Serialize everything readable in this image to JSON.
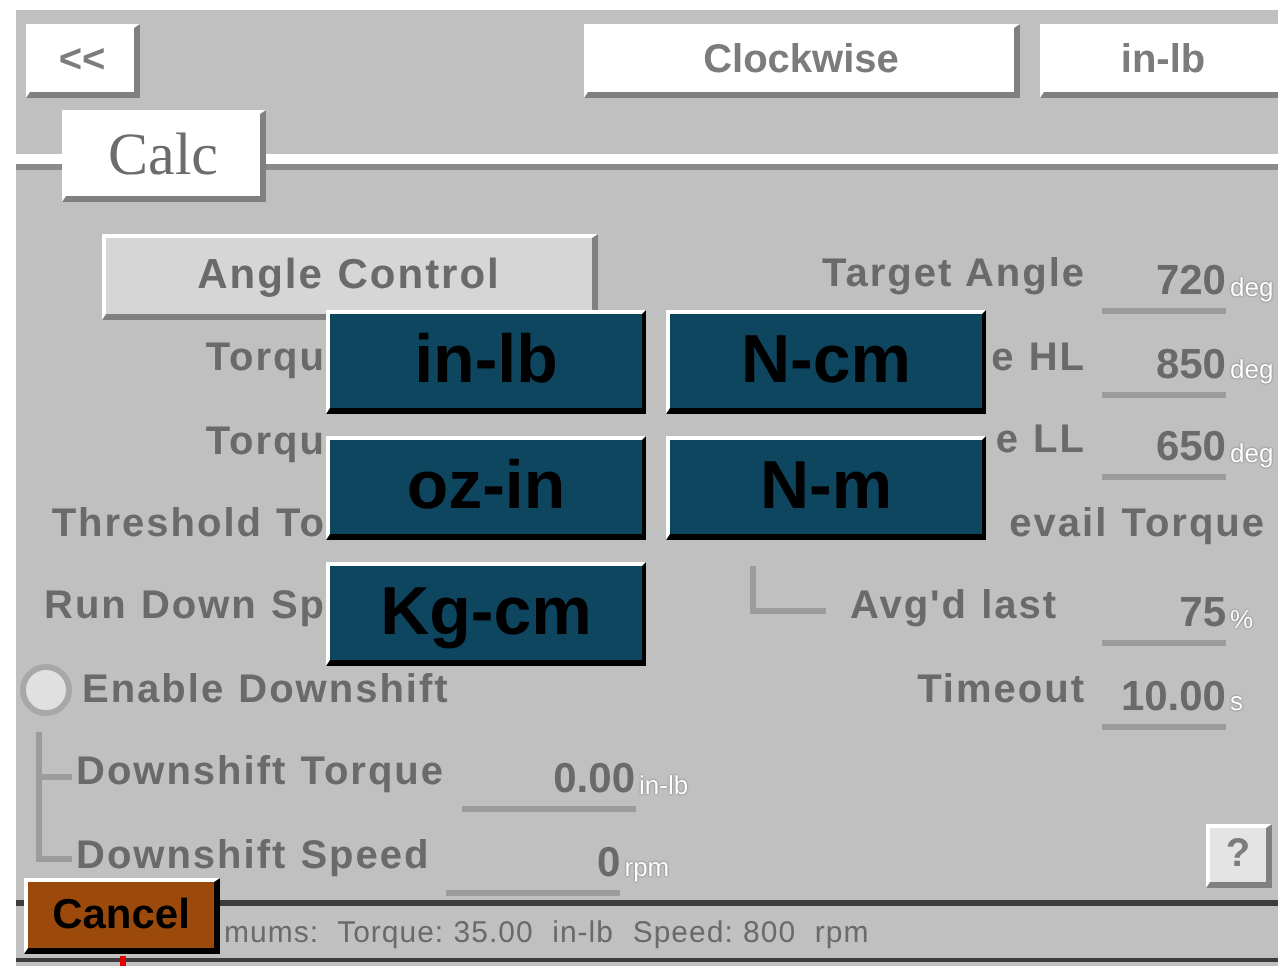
{
  "top_bar": {
    "back_button": "<<",
    "direction_button": "Clockwise",
    "units_button": "in-lb"
  },
  "tabs": [
    {
      "label": "Calc",
      "selected": true
    }
  ],
  "form": {
    "disabled": true,
    "left_rows": [
      {
        "kind": "button",
        "label": "Angle Control"
      },
      {
        "kind": "label",
        "label": "Torqu"
      },
      {
        "kind": "label",
        "label": "Torqu"
      },
      {
        "kind": "label",
        "label": "Threshold To"
      },
      {
        "kind": "label",
        "label": "Run Down Sp"
      },
      {
        "kind": "radio",
        "label": "Enable Downshift",
        "checked": false
      },
      {
        "kind": "branch",
        "label": "Downshift Torque",
        "value": "0.00",
        "unit": "in-lb"
      },
      {
        "kind": "branch",
        "label": "Downshift Speed",
        "value": "0",
        "unit": "rpm"
      }
    ],
    "right_rows": [
      {
        "kind": "field",
        "label": "Target Angle",
        "value": "720",
        "unit": "deg"
      },
      {
        "kind": "field",
        "label": "e HL",
        "value": "850",
        "unit": "deg"
      },
      {
        "kind": "field",
        "label": "e LL",
        "value": "650",
        "unit": "deg"
      },
      {
        "kind": "label",
        "label": "evail Torque"
      },
      {
        "kind": "branch",
        "label": "Avg'd last",
        "value": "75",
        "unit": "%"
      },
      {
        "kind": "field",
        "label": "Timeout",
        "value": "10.00",
        "unit": "s"
      },
      {
        "kind": "empty"
      },
      {
        "kind": "help",
        "label": "?"
      }
    ]
  },
  "status_bar": "mums:  Torque: 35.00  in-lb  Speed: 800  rpm",
  "cancel_button": "Cancel",
  "unit_popup": [
    "in-lb",
    "N-cm",
    "oz-in",
    "N-m",
    "Kg-cm"
  ]
}
